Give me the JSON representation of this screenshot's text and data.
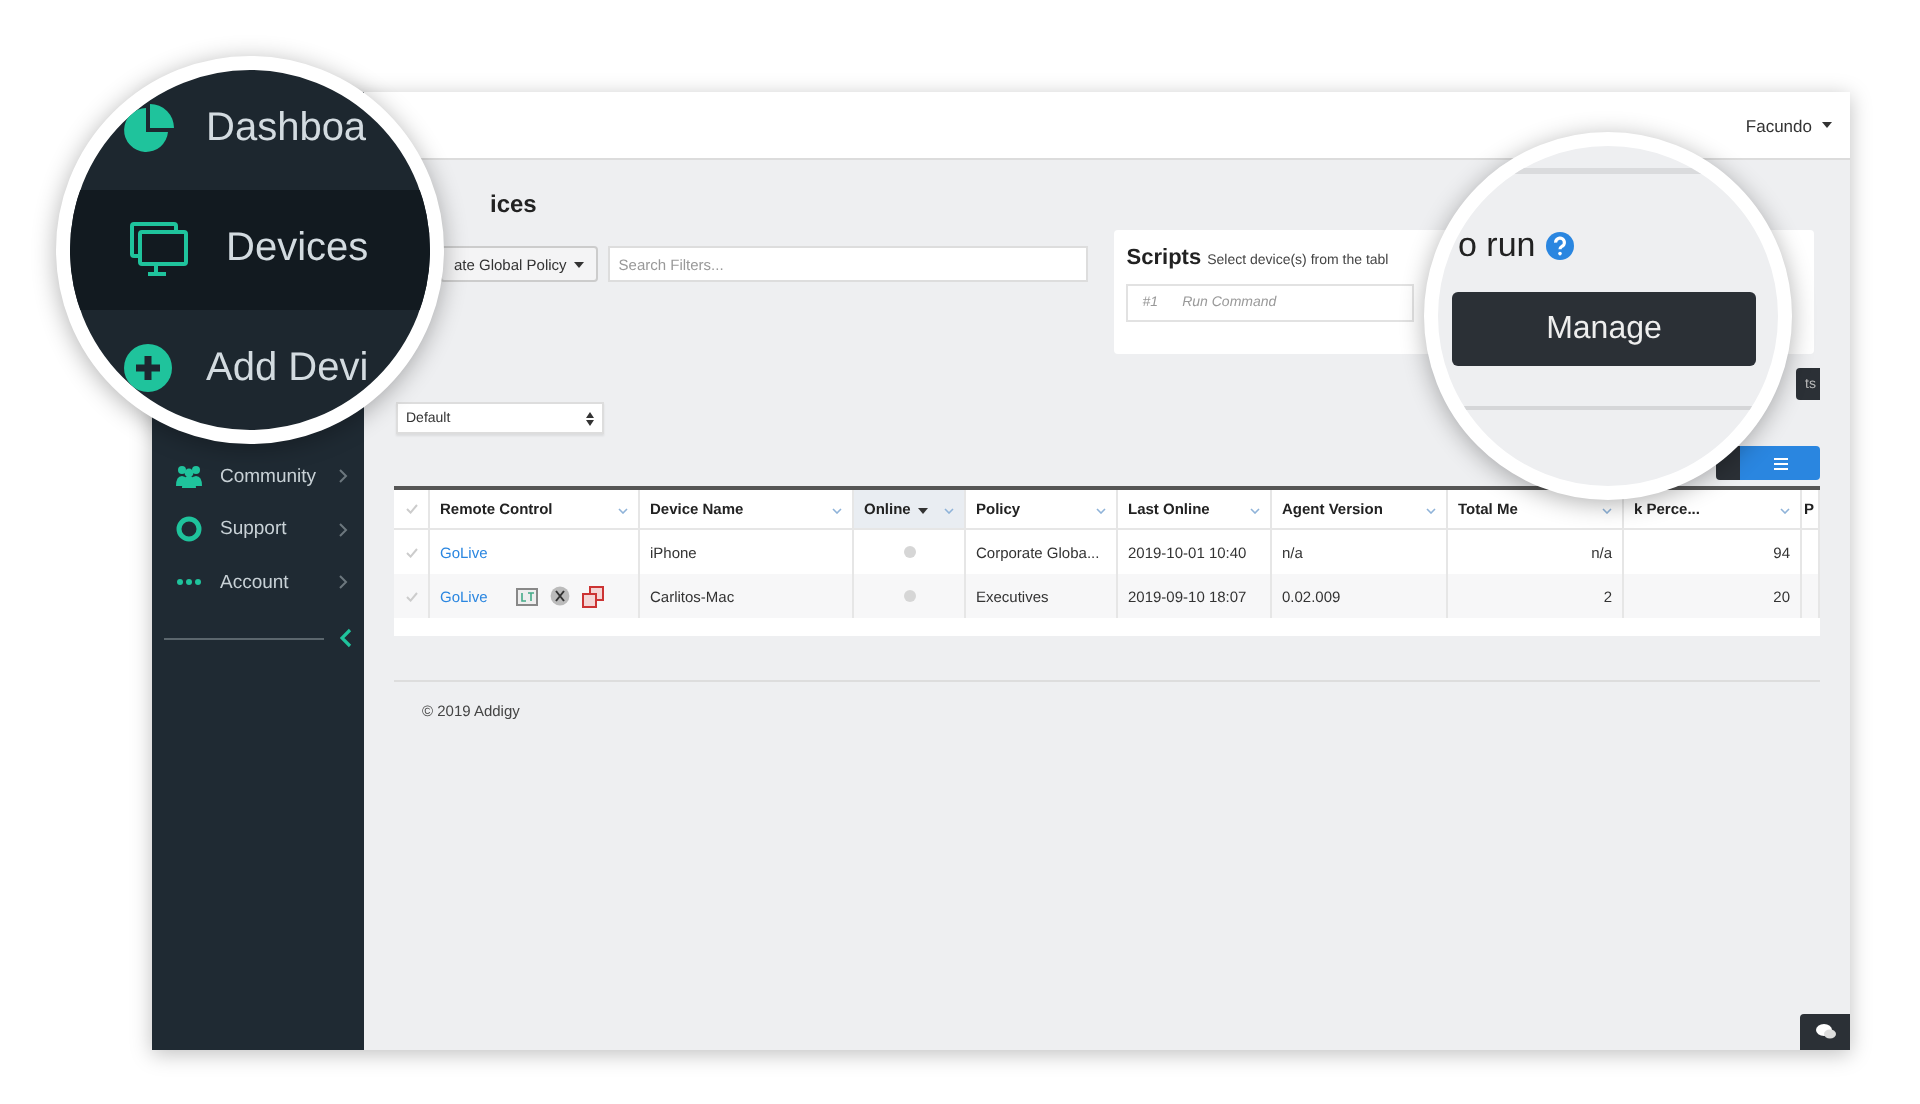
{
  "magnifier_left": {
    "items": [
      {
        "label": "Dashboa",
        "kind": "dashboard",
        "selected": false
      },
      {
        "label": "Devices",
        "kind": "devices",
        "selected": true
      },
      {
        "label": "Add Devi",
        "kind": "add",
        "selected": false
      }
    ]
  },
  "sidebar": {
    "items": [
      {
        "label": "Community",
        "kind": "community"
      },
      {
        "label": "Support",
        "kind": "support"
      },
      {
        "label": "Account",
        "kind": "account"
      }
    ]
  },
  "topbar": {
    "user": "Facundo"
  },
  "page": {
    "heading": "ices",
    "policy_button": "ate Global Policy",
    "search": {
      "placeholder": "Search Filters..."
    },
    "select": {
      "value": "Default"
    }
  },
  "scripts": {
    "title": "Scripts",
    "hint": "Select device(s) from the tabl",
    "command": {
      "number": "#1",
      "placeholder": "Run Command"
    }
  },
  "magnifier_right": {
    "heading": "o run",
    "button": "Manage"
  },
  "toolbar": {
    "partial_button": "ts"
  },
  "table": {
    "columns": [
      {
        "label": "Remote Control",
        "kind": "link",
        "sorted": false
      },
      {
        "label": "Device Name",
        "kind": "text",
        "sorted": false
      },
      {
        "label": "Online",
        "kind": "status",
        "sorted": true
      },
      {
        "label": "Policy",
        "kind": "text",
        "sorted": false
      },
      {
        "label": "Last Online",
        "kind": "text",
        "sorted": false
      },
      {
        "label": "Agent Version",
        "kind": "text",
        "sorted": false
      },
      {
        "label": "Total Me",
        "kind": "number",
        "sorted": false
      },
      {
        "label": "k Perce...",
        "kind": "number",
        "sorted": false
      },
      {
        "label": "P",
        "kind": "text",
        "sorted": false
      }
    ],
    "rows": [
      {
        "selected": false,
        "tools": false,
        "cells": [
          "GoLive",
          "iPhone",
          false,
          "Corporate Globa...",
          "2019-10-01 10:40",
          "n/a",
          "n/a",
          "94"
        ]
      },
      {
        "selected": false,
        "tools": true,
        "cells": [
          "GoLive",
          "Carlitos-Mac",
          false,
          "Executives",
          "2019-09-10 18:07",
          "0.02.009",
          "2",
          "20"
        ]
      }
    ]
  },
  "footer": {
    "copyright": "© 2019 Addigy"
  }
}
